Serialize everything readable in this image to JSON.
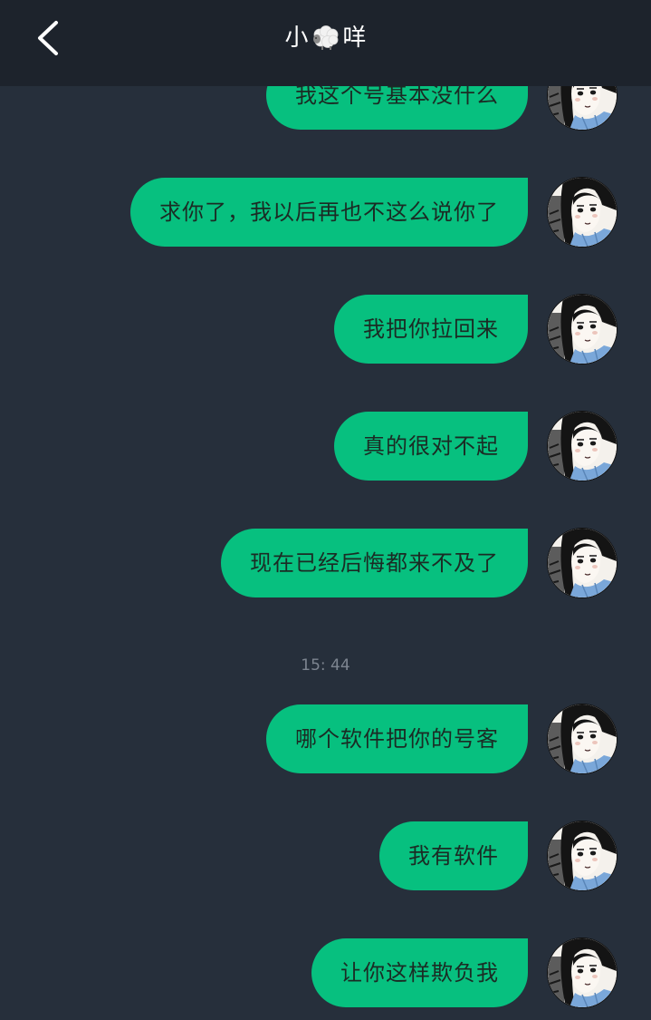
{
  "header": {
    "title_prefix": "小",
    "title_suffix": "咩",
    "title_icon": "sheep-emoji"
  },
  "messages_before": [
    {
      "text": "我这个号基本没什么"
    },
    {
      "text": "求你了，我以后再也不这么说你了"
    },
    {
      "text": "我把你拉回来"
    },
    {
      "text": "真的很对不起"
    },
    {
      "text": "现在已经后悔都来不及了"
    }
  ],
  "timestamp": "15: 44",
  "messages_after": [
    {
      "text": "哪个软件把你的号客"
    },
    {
      "text": "我有软件"
    },
    {
      "text": "让你这样欺负我"
    }
  ],
  "colors": {
    "background": "#262f3b",
    "header": "#1d232c",
    "bubble": "#07c07f"
  }
}
